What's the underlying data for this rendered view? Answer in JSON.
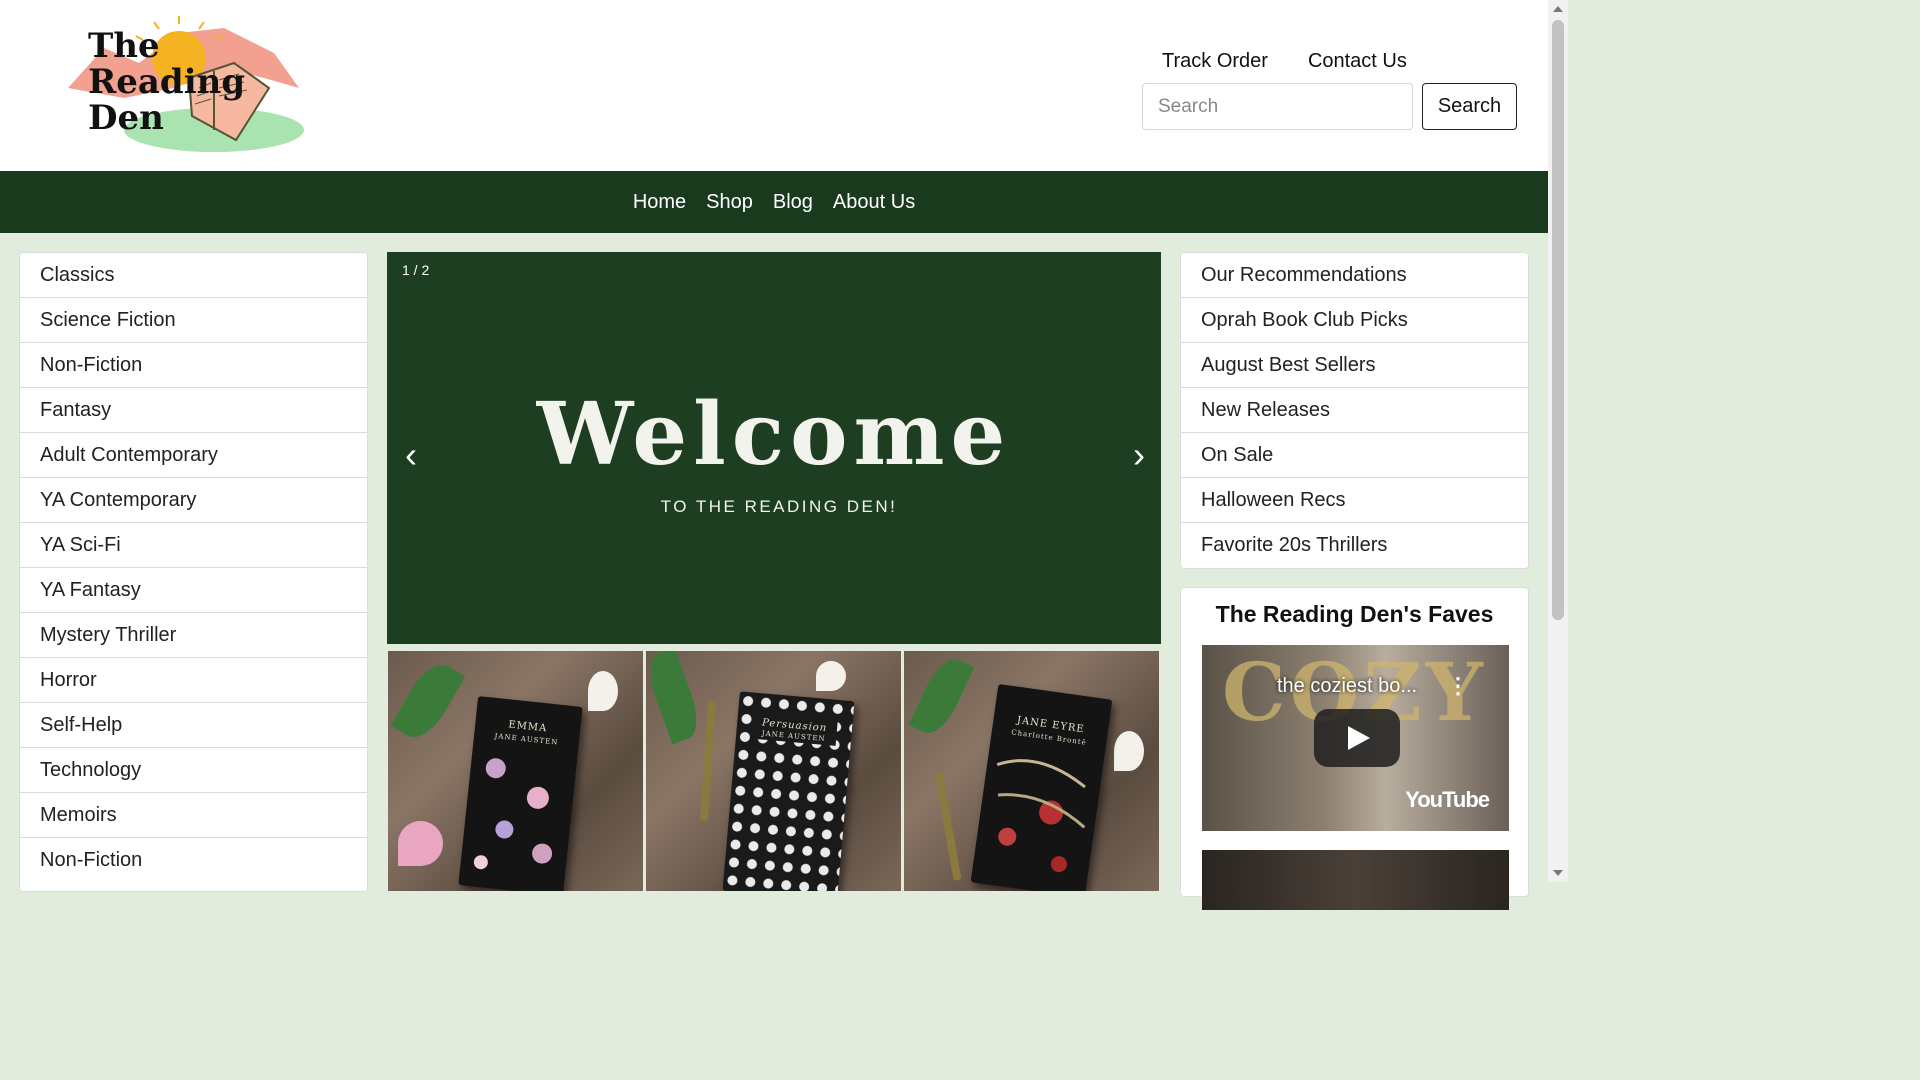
{
  "logo": {
    "line1": "The",
    "line2": "Reading",
    "line3": "Den"
  },
  "top_links": [
    "Track Order",
    "Contact Us"
  ],
  "search": {
    "placeholder": "Search",
    "button_label": "Search"
  },
  "nav": [
    "Home",
    "Shop",
    "Blog",
    "About Us"
  ],
  "categories": [
    "Classics",
    "Science Fiction",
    "Non-Fiction",
    "Fantasy",
    "Adult Contemporary",
    "YA Contemporary",
    "YA Sci-Fi",
    "YA Fantasy",
    "Mystery Thriller",
    "Horror",
    "Self-Help",
    "Technology",
    "Memoirs",
    "Non-Fiction"
  ],
  "carousel": {
    "counter": "1 / 2",
    "headline": "Welcome",
    "subheadline": "TO THE READING DEN!",
    "prev": "‹",
    "next": "›"
  },
  "photos": [
    {
      "book_title": "EMMA",
      "book_author": "JANE AUSTEN"
    },
    {
      "book_title": "Persuasion",
      "book_author": "JANE AUSTEN"
    },
    {
      "book_title": "JANE EYRE",
      "book_author": "Charlotte Brontë"
    }
  ],
  "recommendations": [
    "Our Recommendations",
    "Oprah Book Club Picks",
    "August Best Sellers",
    "New Releases",
    "On Sale",
    "Halloween Recs",
    "Favorite 20s Thrillers"
  ],
  "faves": {
    "title": "The Reading Den's Faves",
    "video_title": "the coziest bo...",
    "video_overlay_text": "COZY",
    "video_platform": "YouTube"
  },
  "colors": {
    "nav_bg": "#1a3a1e",
    "page_bg": "#e2ecdd",
    "carousel_bg": "#1d3e20"
  }
}
